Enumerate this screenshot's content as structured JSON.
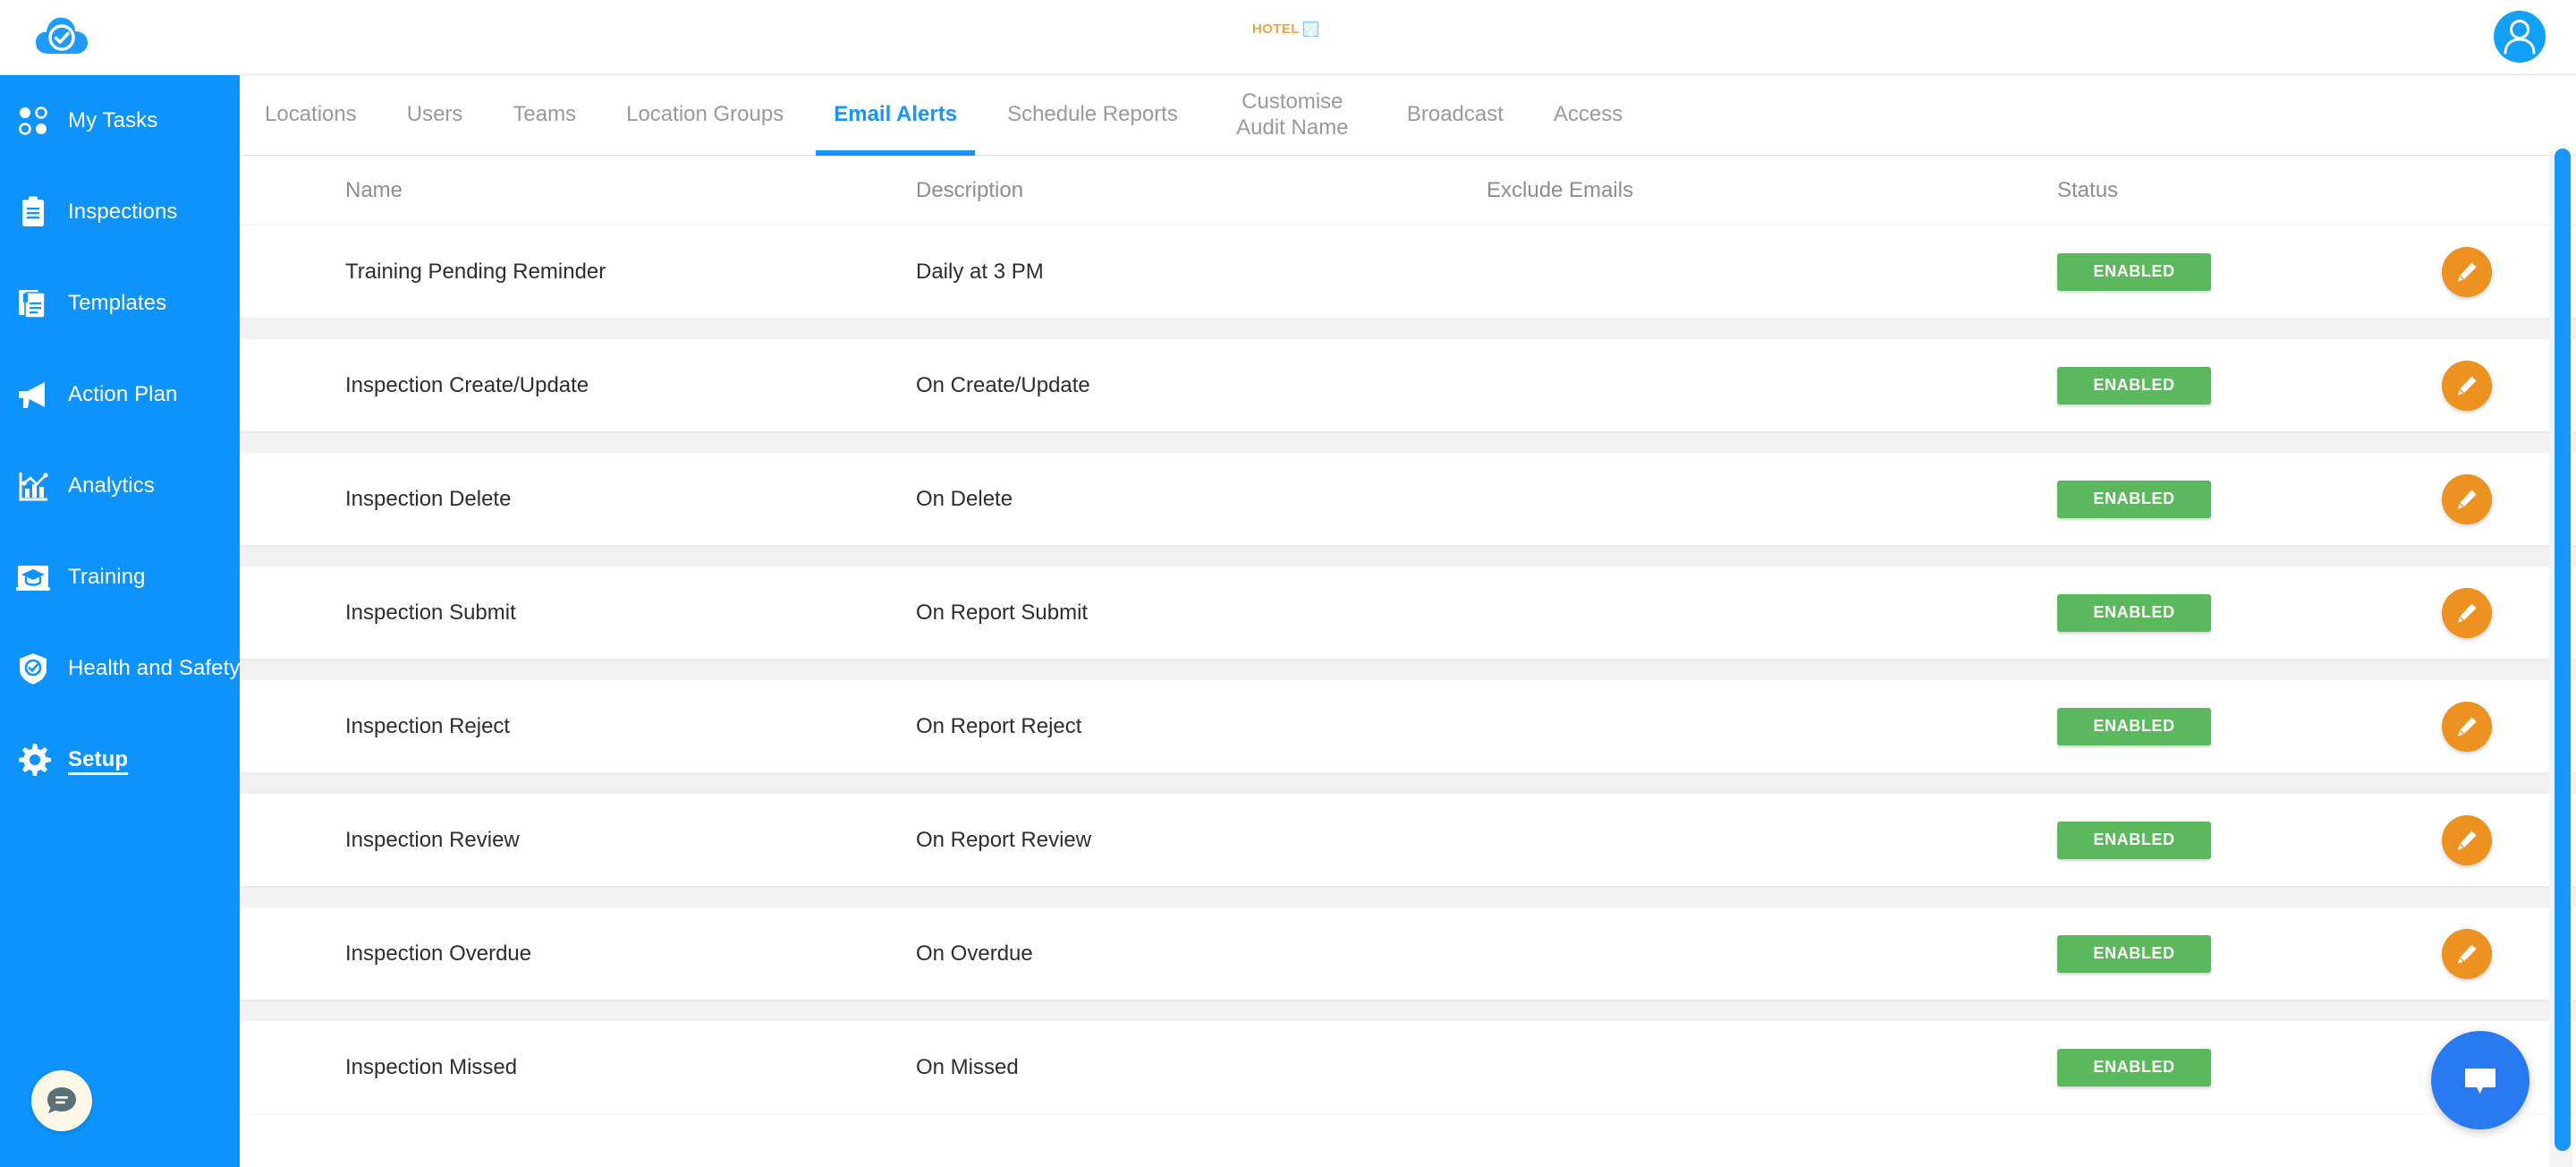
{
  "header": {
    "brand_logo_icon": "cloud-check-icon",
    "center_logo_text": "HOTEL",
    "center_logo_icon": "building-icon",
    "avatar_icon": "user-avatar-icon"
  },
  "sidebar": {
    "items": [
      {
        "label": "My Tasks",
        "icon": "four-dots-icon",
        "active": false
      },
      {
        "label": "Inspections",
        "icon": "clipboard-icon",
        "active": false
      },
      {
        "label": "Templates",
        "icon": "documents-icon",
        "active": false
      },
      {
        "label": "Action Plan",
        "icon": "megaphone-icon",
        "active": false
      },
      {
        "label": "Analytics",
        "icon": "bar-chart-icon",
        "active": false
      },
      {
        "label": "Training",
        "icon": "graduation-cap-icon",
        "active": false
      },
      {
        "label": "Health and Safety",
        "icon": "shield-check-icon",
        "active": false
      },
      {
        "label": "Setup",
        "icon": "gear-icon",
        "active": true
      }
    ],
    "chat_icon": "chat-bubble-icon"
  },
  "tabs": [
    {
      "label": "Locations",
      "active": false
    },
    {
      "label": "Users",
      "active": false
    },
    {
      "label": "Teams",
      "active": false
    },
    {
      "label": "Location Groups",
      "active": false
    },
    {
      "label": "Email Alerts",
      "active": true
    },
    {
      "label": "Schedule Reports",
      "active": false
    },
    {
      "label": "Customise Audit Name",
      "active": false
    },
    {
      "label": "Broadcast",
      "active": false
    },
    {
      "label": "Access",
      "active": false
    }
  ],
  "table": {
    "columns": [
      "Name",
      "Description",
      "Exclude Emails",
      "Status"
    ],
    "rows": [
      {
        "name": "Training Pending Reminder",
        "description": "Daily at 3 PM",
        "exclude_emails": "",
        "status": "ENABLED",
        "edit_icon": "pencil-icon"
      },
      {
        "name": "Inspection Create/Update",
        "description": "On Create/Update",
        "exclude_emails": "",
        "status": "ENABLED",
        "edit_icon": "pencil-icon"
      },
      {
        "name": "Inspection Delete",
        "description": "On Delete",
        "exclude_emails": "",
        "status": "ENABLED",
        "edit_icon": "pencil-icon"
      },
      {
        "name": "Inspection Submit",
        "description": "On Report Submit",
        "exclude_emails": "",
        "status": "ENABLED",
        "edit_icon": "pencil-icon"
      },
      {
        "name": "Inspection Reject",
        "description": "On Report Reject",
        "exclude_emails": "",
        "status": "ENABLED",
        "edit_icon": "pencil-icon"
      },
      {
        "name": "Inspection Review",
        "description": "On Report Review",
        "exclude_emails": "",
        "status": "ENABLED",
        "edit_icon": "pencil-icon"
      },
      {
        "name": "Inspection Overdue",
        "description": "On Overdue",
        "exclude_emails": "",
        "status": "ENABLED",
        "edit_icon": "pencil-icon"
      },
      {
        "name": "Inspection Missed",
        "description": "On Missed",
        "exclude_emails": "",
        "status": "ENABLED",
        "edit_icon": "pencil-icon"
      }
    ]
  },
  "chat_widget": {
    "icon": "chat-bubble-icon"
  },
  "colors": {
    "sidebar_blue": "#0d93fb",
    "accent_blue": "#1594fb",
    "status_green": "#5cb85c",
    "edit_orange": "#ed9121",
    "hotel_orange": "#f5a341",
    "chat_blue": "#2979f0"
  }
}
